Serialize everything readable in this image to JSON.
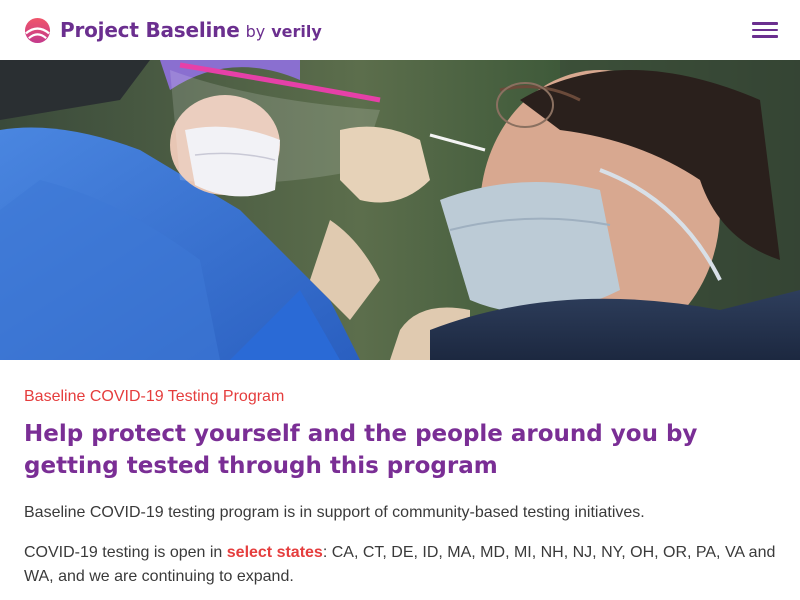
{
  "header": {
    "brand_name": "Project Baseline",
    "brand_by": "by",
    "brand_partner": "verily",
    "logo_icon": "baseline-logo-icon",
    "menu_icon": "hamburger-menu-icon"
  },
  "hero": {
    "image_icon": "covid-swab-test-photo"
  },
  "main": {
    "eyebrow": "Baseline COVID-19 Testing Program",
    "headline": "Help protect yourself and the people around you by getting tested through this program",
    "intro": "Baseline COVID-19 testing program is in support of community-based testing initiatives.",
    "availability_prefix": "COVID-19 testing is open in ",
    "availability_link": "select states",
    "availability_suffix": ": CA, CT, DE, ID, MA, MD, MI, NH, NJ, NY, OH, OR, PA, VA and WA, and we are continuing to expand."
  },
  "colors": {
    "brand_purple": "#6b2f8f",
    "headline_purple": "#7a2e95",
    "accent_red": "#e53d3d",
    "body_text": "#3a3a3a"
  }
}
